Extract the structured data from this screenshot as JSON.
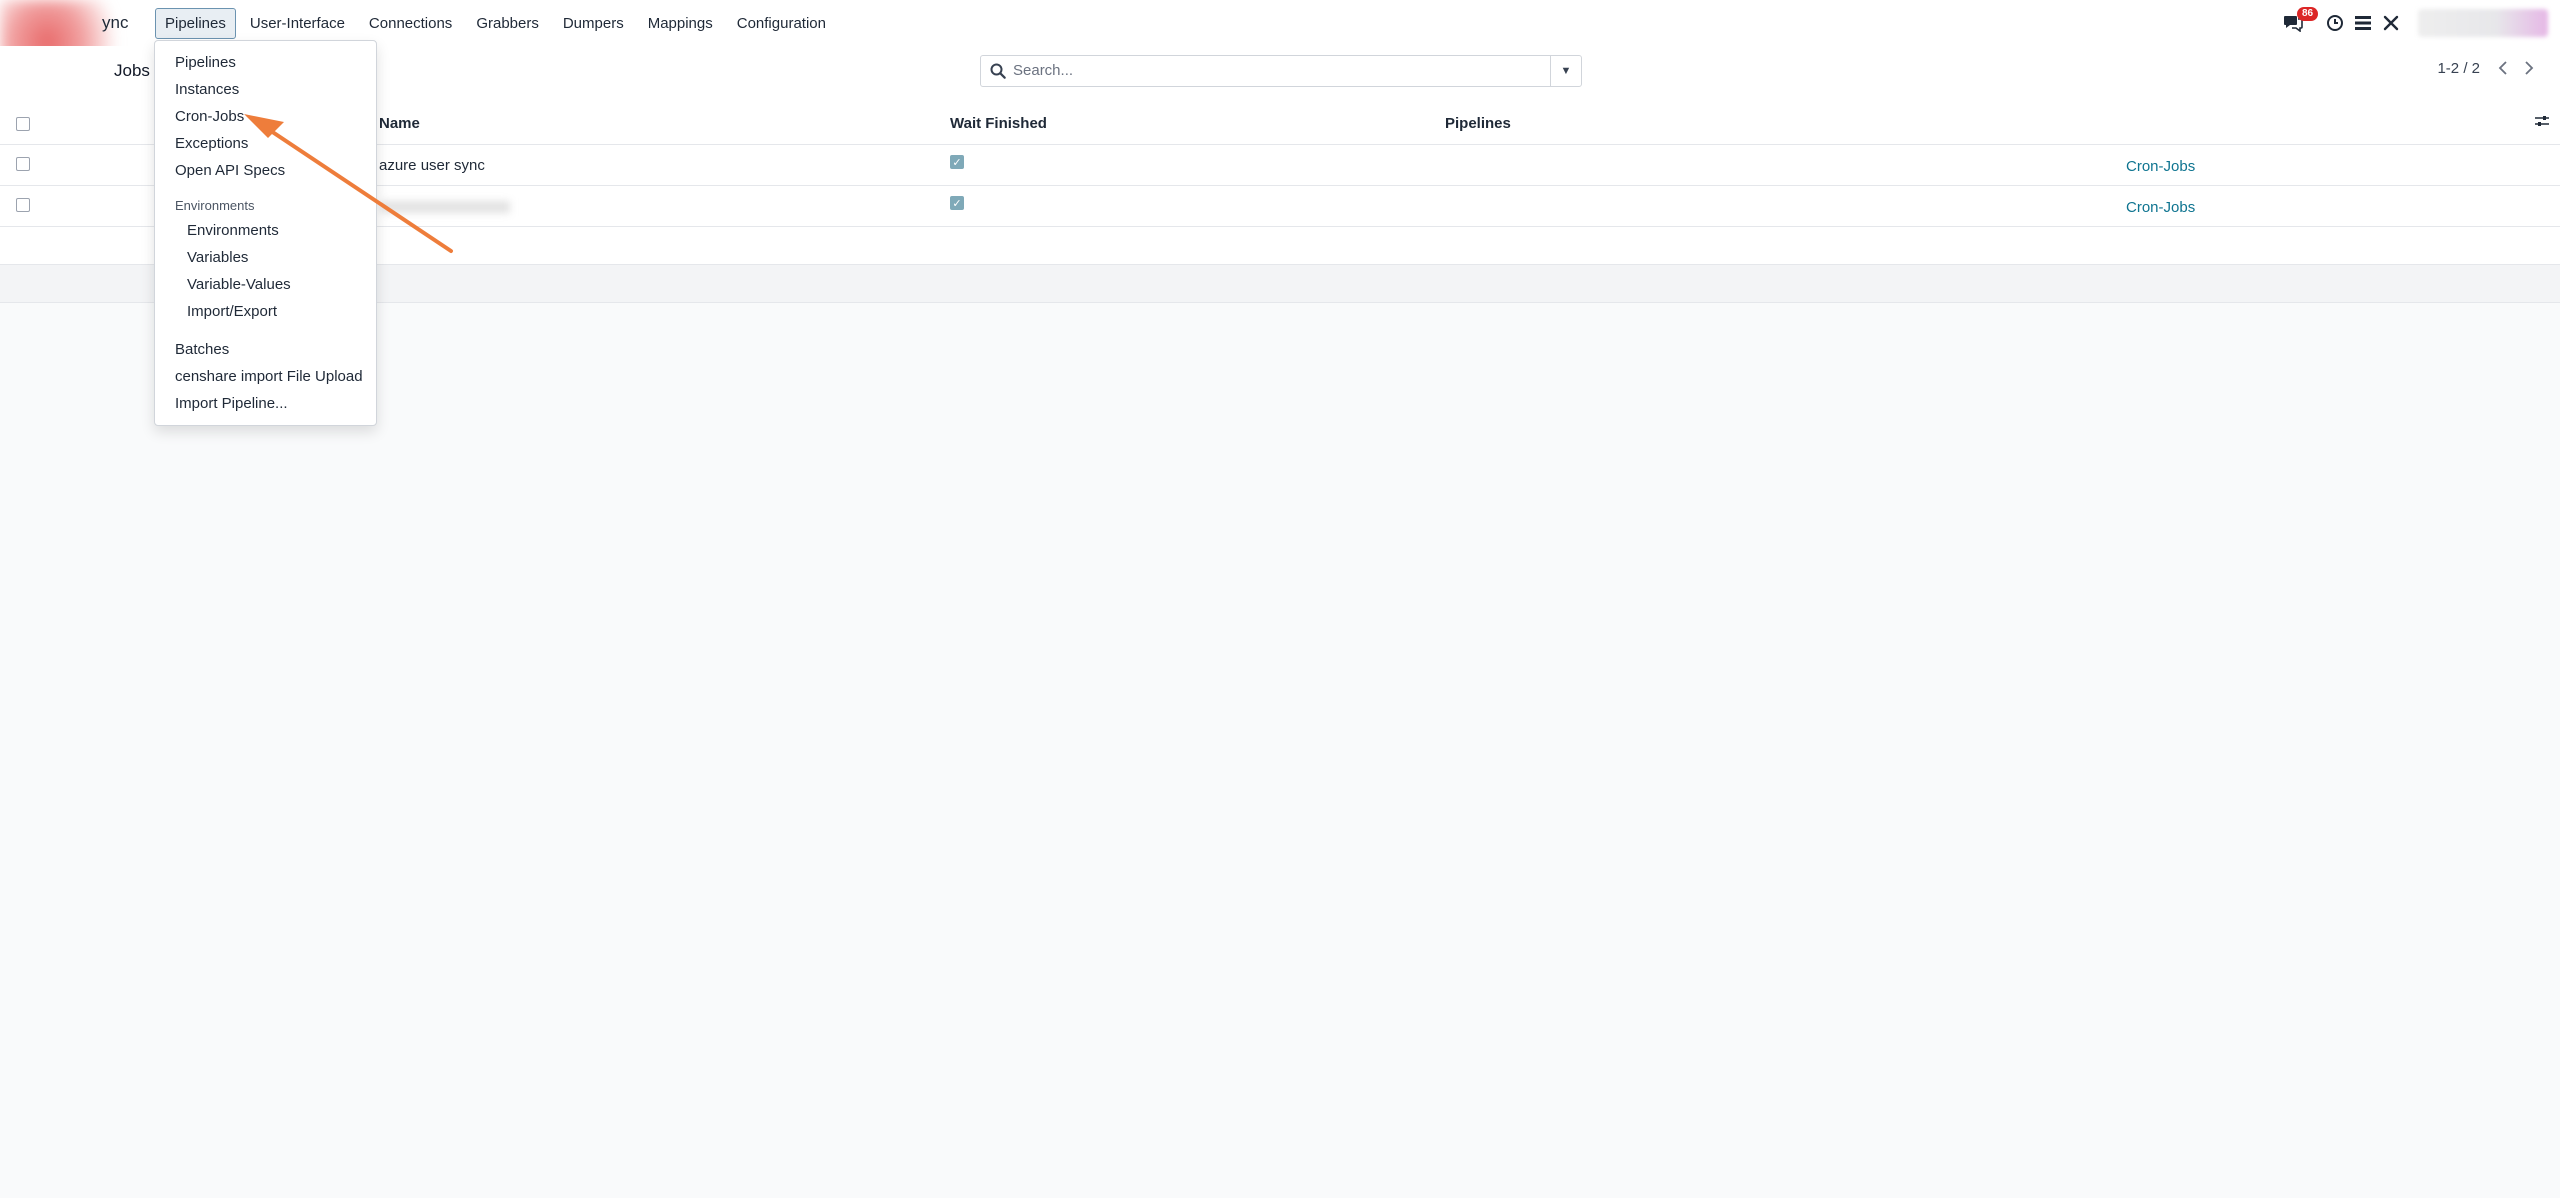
{
  "navbar": {
    "app_name": "ync",
    "menu": [
      "Pipelines",
      "User-Interface",
      "Connections",
      "Grabbers",
      "Dumpers",
      "Mappings",
      "Configuration"
    ],
    "messages_badge": "86",
    "icons": [
      "chat-icon",
      "clock-icon",
      "list-icon",
      "tools-icon"
    ]
  },
  "control": {
    "breadcrumb": "Jobs",
    "search_placeholder": "Search...",
    "pager_value": "1-2 / 2"
  },
  "table": {
    "columns": [
      "Name",
      "Wait Finished",
      "Pipelines"
    ],
    "rows": [
      {
        "name": "azure user sync",
        "wait_finished": true,
        "link": "Cron-Jobs"
      },
      {
        "name": "",
        "wait_finished": true,
        "link": "Cron-Jobs"
      }
    ]
  },
  "dropdown": {
    "items": [
      "Pipelines",
      "Instances",
      "Cron-Jobs",
      "Exceptions",
      "Open API Specs"
    ],
    "section_header": "Environments",
    "section_items": [
      "Environments",
      "Variables",
      "Variable-Values",
      "Import/Export"
    ],
    "bottom_items": [
      "Batches",
      "censhare import File Upload",
      "Import Pipeline..."
    ]
  },
  "colors": {
    "accent_link": "#0e7490",
    "arrow": "#ee7d3b",
    "badge": "#dc2626"
  }
}
